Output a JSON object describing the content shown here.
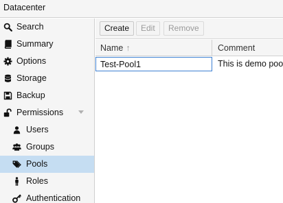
{
  "window": {
    "title": "Datacenter"
  },
  "sidebar": {
    "items": [
      {
        "label": "Search",
        "icon": "search-icon"
      },
      {
        "label": "Summary",
        "icon": "book-icon"
      },
      {
        "label": "Options",
        "icon": "gear-icon"
      },
      {
        "label": "Storage",
        "icon": "database-icon"
      },
      {
        "label": "Backup",
        "icon": "floppy-icon"
      },
      {
        "label": "Permissions",
        "icon": "unlock-icon"
      },
      {
        "label": "Users",
        "icon": "user-icon"
      },
      {
        "label": "Groups",
        "icon": "users-icon"
      },
      {
        "label": "Pools",
        "icon": "tags-icon"
      },
      {
        "label": "Roles",
        "icon": "male-icon"
      },
      {
        "label": "Authentication",
        "icon": "key-icon"
      }
    ],
    "active": "Pools"
  },
  "toolbar": {
    "create_label": "Create",
    "edit_label": "Edit",
    "remove_label": "Remove"
  },
  "grid": {
    "columns": [
      {
        "label": "Name",
        "sort": "ascending"
      },
      {
        "label": "Comment"
      }
    ],
    "rows": [
      {
        "name": "Test-Pool1",
        "comment": "This is demo pool"
      }
    ]
  },
  "colors": {
    "selection": "#c5ddf2",
    "focus_border": "#3b7fd2"
  }
}
